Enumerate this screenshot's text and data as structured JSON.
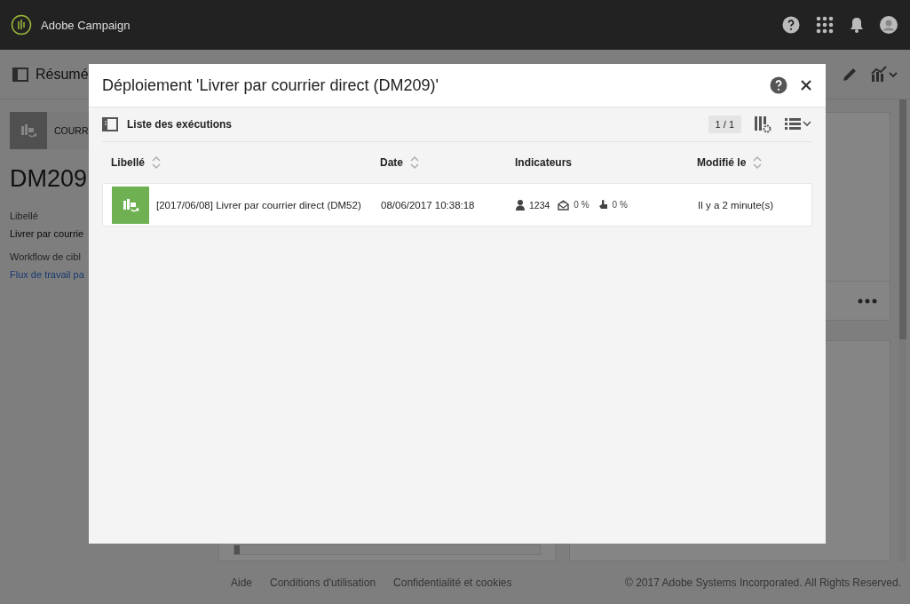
{
  "app_bar": {
    "title": "Adobe Campaign"
  },
  "page": {
    "toolbar_title": "Résumé",
    "card_label": "COURR",
    "heading": "DM209",
    "fields": [
      {
        "kind": "text",
        "label": "Libellé",
        "value": "Livrer par courrie"
      },
      {
        "kind": "link",
        "label": "Workflow de cibl",
        "value": "Flux de travail pa"
      }
    ]
  },
  "modal": {
    "title": "Déploiement 'Livrer par courrier direct (DM209)'",
    "section_title": "Liste des exécutions",
    "pagination": "1 / 1",
    "columns": [
      {
        "label": "Libellé",
        "sortable": true
      },
      {
        "label": "Date",
        "sortable": true
      },
      {
        "label": "Indicateurs",
        "sortable": false
      },
      {
        "label": "Modifié le",
        "sortable": true
      }
    ],
    "rows": [
      {
        "label": "[2017/06/08] Livrer par courrier direct (DM52)",
        "date": "08/06/2017 10:38:18",
        "recipients": "1234",
        "opens": "0 %",
        "clicks": "0 %",
        "modified": "Il y a 2 minute(s)"
      }
    ]
  },
  "footer": {
    "links": [
      "Aide",
      "Conditions d'utilisation",
      "Confidentialité et cookies"
    ],
    "copyright": "© 2017 Adobe Systems Incorporated. All Rights Reserved."
  }
}
